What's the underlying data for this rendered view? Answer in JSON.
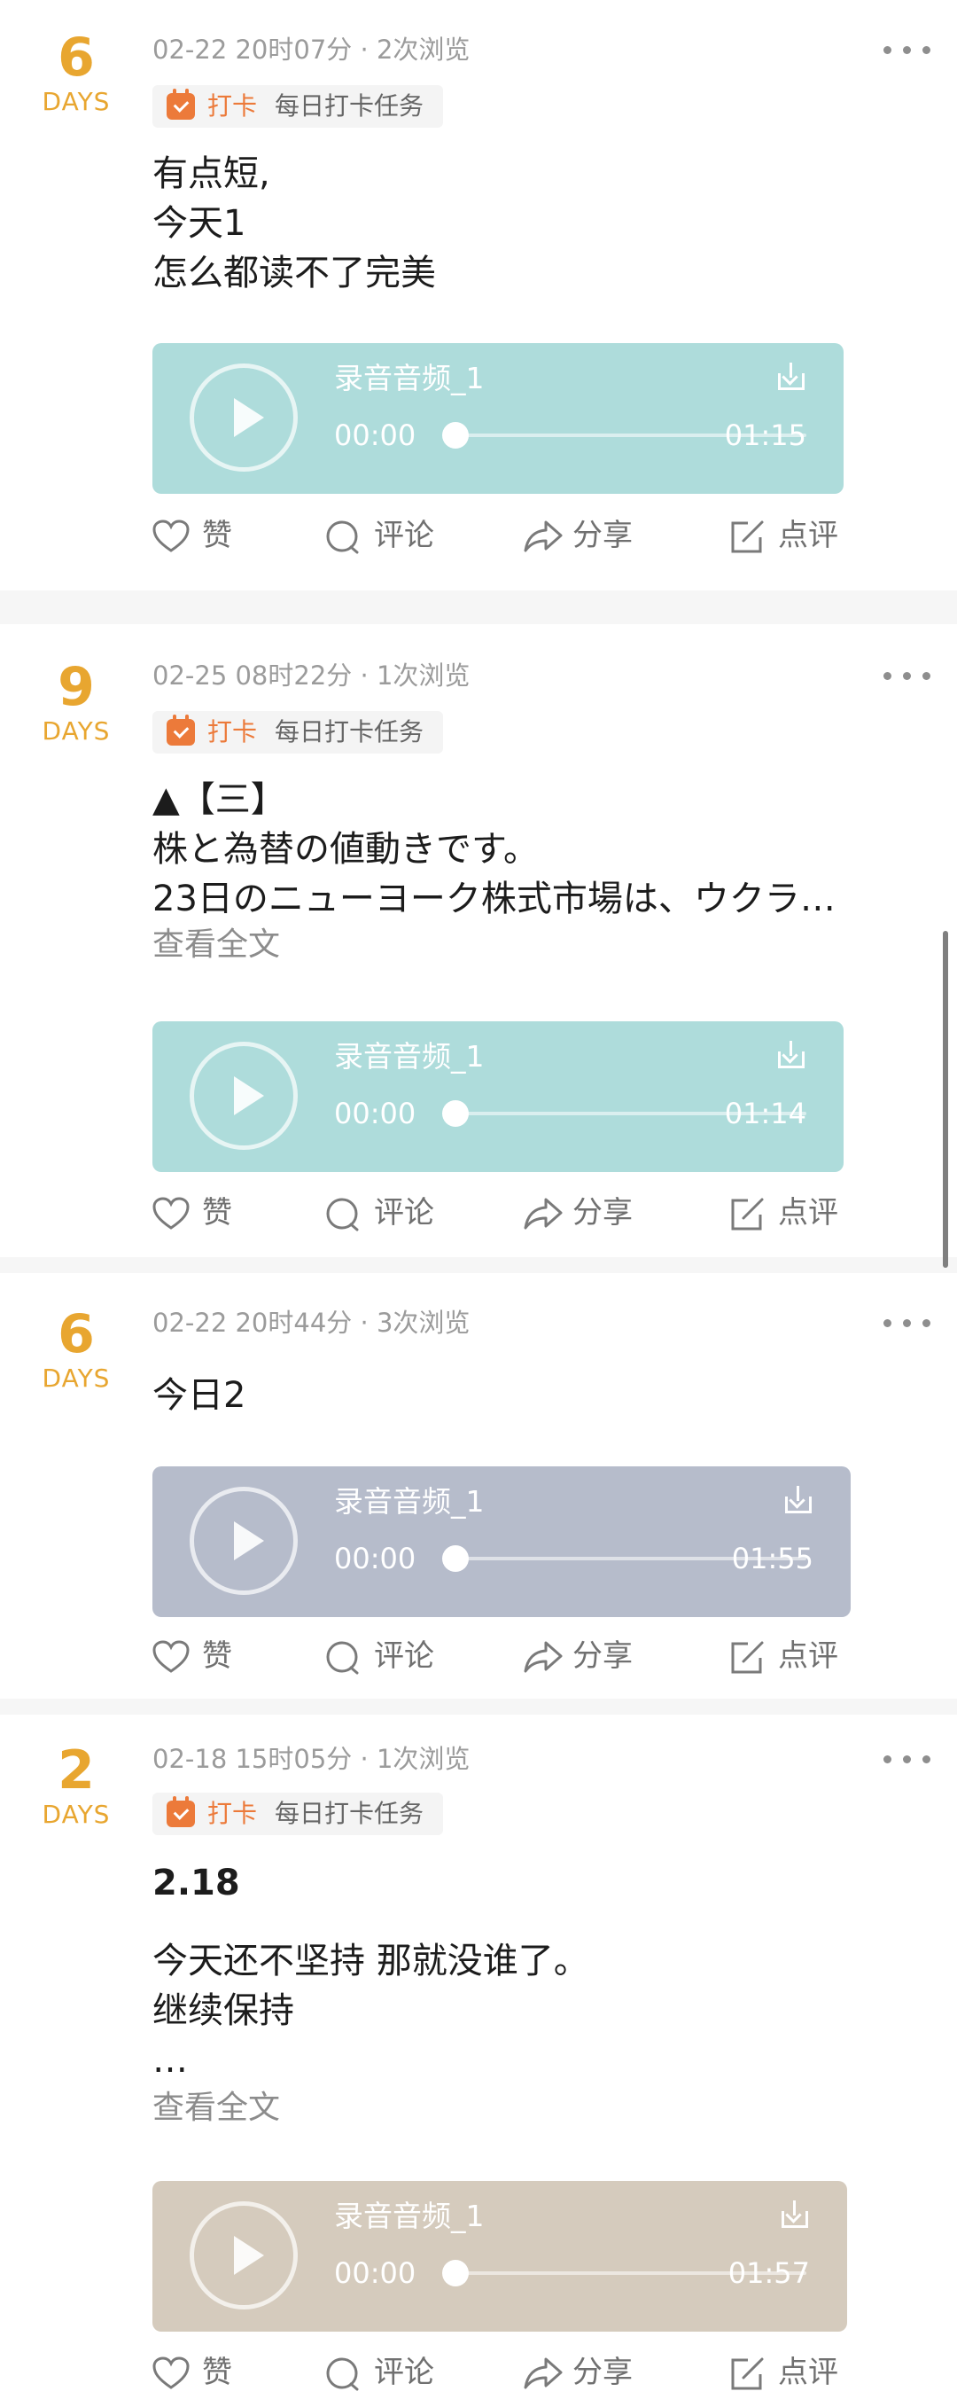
{
  "posts": [
    {
      "days": "6",
      "days_label": "DAYS",
      "meta": "02-22 20时07分 · 2次浏览",
      "tag": {
        "type": "打卡",
        "name": "每日打卡任务"
      },
      "lines": [
        "有点短,",
        "今天1",
        "怎么都读不了完美"
      ],
      "read_more": "",
      "audio": {
        "title": "录音音频_1",
        "start": "00:00",
        "end": "01:15",
        "color": "#aedcdb",
        "progress": 0
      }
    },
    {
      "days": "9",
      "days_label": "DAYS",
      "meta": "02-25 08时22分 · 1次浏览",
      "tag": {
        "type": "打卡",
        "name": "每日打卡任务"
      },
      "lines": [
        "▲【三】",
        "株と為替の値動きです。",
        "23日のニューヨーク株式市場は、ウクラ…"
      ],
      "read_more": "查看全文",
      "audio": {
        "title": "录音音频_1",
        "start": "00:00",
        "end": "01:14",
        "color": "#aedcdb",
        "progress": 0
      }
    },
    {
      "days": "6",
      "days_label": "DAYS",
      "meta": "02-22 20时44分 · 3次浏览",
      "lines": [
        "今日2"
      ],
      "read_more": "",
      "audio": {
        "title": "录音音频_1",
        "start": "00:00",
        "end": "01:55",
        "color": "#b6bccb",
        "progress": 0
      }
    },
    {
      "days": "2",
      "days_label": "DAYS",
      "meta": "02-18 15时05分 · 1次浏览",
      "tag": {
        "type": "打卡",
        "name": "每日打卡任务"
      },
      "title": "2.18",
      "lines": [
        "今天还不坚持 那就没谁了。",
        "继续保持",
        "…"
      ],
      "read_more": "查看全文",
      "audio": {
        "title": "录音音频_1",
        "start": "00:00",
        "end": "01:57",
        "color": "#d5cbbd",
        "progress": 0
      }
    }
  ],
  "actions": {
    "like": "赞",
    "comment": "评论",
    "share": "分享",
    "review": "点评"
  }
}
